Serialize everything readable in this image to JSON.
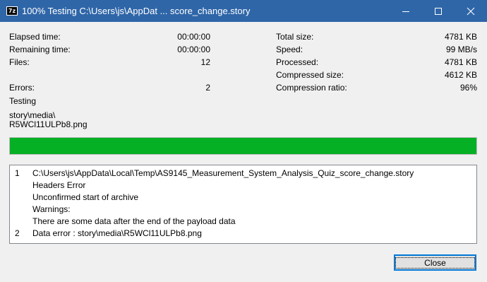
{
  "window": {
    "title": "100% Testing C:\\Users\\js\\AppDat ... score_change.story",
    "app_icon_text": "7z"
  },
  "stats_left": [
    {
      "label": "Elapsed time:",
      "value": "00:00:00"
    },
    {
      "label": "Remaining time:",
      "value": "00:00:00"
    },
    {
      "label": "Files:",
      "value": "12"
    },
    {
      "label": "Errors:",
      "value": "2"
    }
  ],
  "stats_right": [
    {
      "label": "Total size:",
      "value": "4781 KB"
    },
    {
      "label": "Speed:",
      "value": "99 MB/s"
    },
    {
      "label": "Processed:",
      "value": "4781 KB"
    },
    {
      "label": "Compressed size:",
      "value": "4612 KB"
    },
    {
      "label": "Compression ratio:",
      "value": "96%"
    }
  ],
  "operation": "Testing",
  "current_file": {
    "line1": "story\\media\\",
    "line2": "R5WCl11ULPb8.png"
  },
  "progress": {
    "percent": 100,
    "color": "#06b025"
  },
  "log": [
    {
      "num": "1",
      "text": "C:\\Users\\js\\AppData\\Local\\Temp\\AS9145_Measurement_System_Analysis_Quiz_score_change.story"
    },
    {
      "num": "",
      "text": "Headers Error"
    },
    {
      "num": "",
      "text": "Unconfirmed start of archive"
    },
    {
      "num": "",
      "text": "Warnings:"
    },
    {
      "num": "",
      "text": "There are some data after the end of the payload data"
    },
    {
      "num": "2",
      "text": "Data error : story\\media\\R5WCl11ULPb8.png"
    }
  ],
  "buttons": {
    "close_label": "Close"
  },
  "colors": {
    "titlebar": "#2f66a8",
    "accent": "#0078d7"
  }
}
